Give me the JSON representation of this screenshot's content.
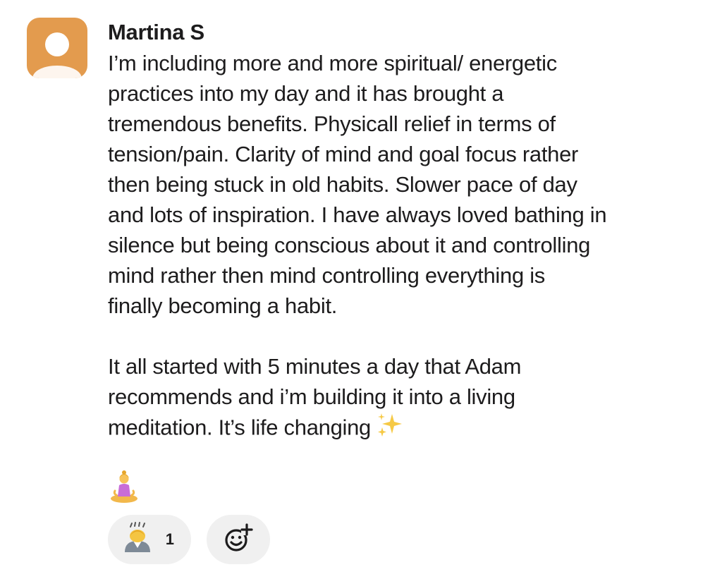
{
  "author": {
    "name": "Martina S",
    "avatar_icon": "person-silhouette-icon",
    "avatar_color": "#e39b4e"
  },
  "message": {
    "paragraph1_lines": [
      "I’m including more and more spiritual/ energetic",
      "practices into my day and it has brought a",
      "tremendous benefits. Physicall relief in terms of",
      "tension/pain. Clarity of mind and goal focus rather",
      "then being stuck in old habits. Slower pace of day",
      "and lots of inspiration. I have always loved bathing in",
      "silence but being conscious about it and controlling",
      "mind rather then mind controlling everything is",
      "finally becoming a habit."
    ],
    "paragraph2_lines": [
      "It all started with 5 minutes a day that Adam",
      "recommends and i’m building it into a living",
      "meditation. It’s life changing"
    ],
    "trailing_emoji": "sparkles-icon",
    "attached_emoji": "woman-in-lotus-position-icon"
  },
  "reactions": [
    {
      "emoji": "person-bowing-icon",
      "count": "1"
    }
  ],
  "add_reaction_icon": "add-reaction-icon"
}
